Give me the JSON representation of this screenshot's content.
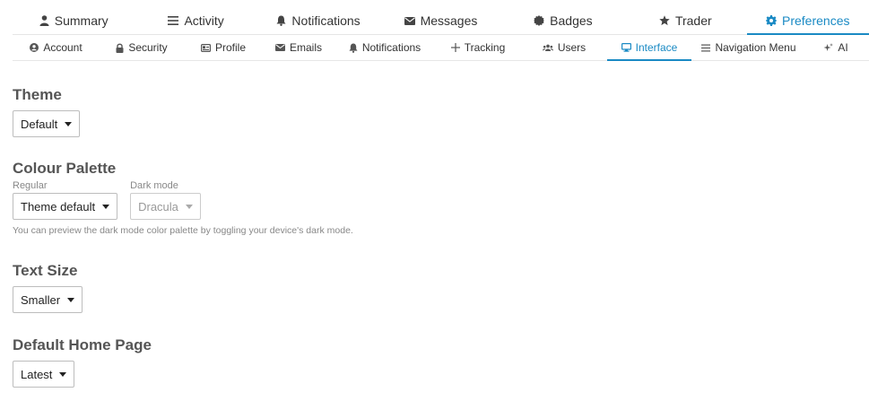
{
  "main_tabs": [
    {
      "label": "Summary",
      "icon": "user-icon",
      "active": false
    },
    {
      "label": "Activity",
      "icon": "stream-icon",
      "active": false
    },
    {
      "label": "Notifications",
      "icon": "bell-icon",
      "active": false
    },
    {
      "label": "Messages",
      "icon": "envelope-icon",
      "active": false
    },
    {
      "label": "Badges",
      "icon": "certificate-icon",
      "active": false
    },
    {
      "label": "Trader",
      "icon": "star-icon",
      "active": false
    },
    {
      "label": "Preferences",
      "icon": "cog-icon",
      "active": true
    }
  ],
  "sub_tabs": [
    {
      "label": "Account",
      "icon": "user-circle-icon"
    },
    {
      "label": "Security",
      "icon": "lock-icon"
    },
    {
      "label": "Profile",
      "icon": "id-card-icon"
    },
    {
      "label": "Emails",
      "icon": "envelope-icon"
    },
    {
      "label": "Notifications",
      "icon": "bell-icon"
    },
    {
      "label": "Tracking",
      "icon": "plus-icon"
    },
    {
      "label": "Users",
      "icon": "users-icon"
    },
    {
      "label": "Interface",
      "icon": "desktop-icon"
    },
    {
      "label": "Navigation Menu",
      "icon": "bars-icon"
    },
    {
      "label": "AI",
      "icon": "sparkle-icon"
    }
  ],
  "theme": {
    "title": "Theme",
    "value": "Default"
  },
  "palette": {
    "title": "Colour Palette",
    "regular_label": "Regular",
    "regular_value": "Theme default",
    "dark_label": "Dark mode",
    "dark_value": "Dracula",
    "hint": "You can preview the dark mode color palette by toggling your device's dark mode."
  },
  "text_size": {
    "title": "Text Size",
    "value": "Smaller"
  },
  "home_page": {
    "title": "Default Home Page",
    "value": "Latest"
  },
  "colors": {
    "accent": "#1a8ac4"
  }
}
